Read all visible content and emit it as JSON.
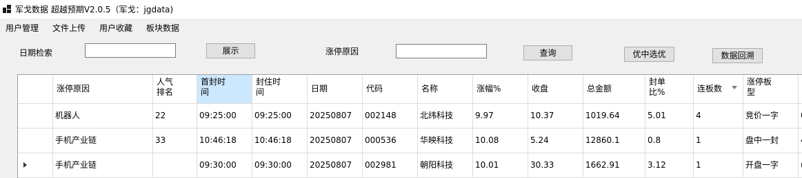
{
  "window": {
    "title": "军戈数据 超越预期V2.0.5（军戈：jgdata)"
  },
  "menu": [
    "用户管理",
    "文件上传",
    "用户收藏",
    "板块数据"
  ],
  "toolbar": {
    "date_label": "日期检索",
    "date_value": "",
    "show_button": "展示",
    "reason_label": "涨停原因",
    "reason_value": "",
    "query_button": "查询",
    "select_button": "优中选优",
    "backtrack_button": "数据回溯"
  },
  "table": {
    "columns": [
      "涨停原因",
      "人气排名",
      "首封时间",
      "封住时间",
      "日期",
      "代码",
      "名称",
      "涨幅%",
      "收盘",
      "总金额",
      "封单比%",
      "连板数",
      "涨停板型"
    ],
    "rows": [
      [
        "机器人",
        "22",
        "09:25:00",
        "09:25:00",
        "20250807",
        "002148",
        "北纬科技",
        "9.97",
        "10.37",
        "1019.64",
        "5.01",
        "4",
        "竞价一字"
      ],
      [
        "手机产业链",
        "33",
        "10:46:18",
        "10:46:18",
        "20250807",
        "000536",
        "华映科技",
        "10.08",
        "5.24",
        "12860.1",
        "0.8",
        "1",
        "盘中一封"
      ],
      [
        "手机产业链",
        "",
        "09:30:00",
        "09:30:00",
        "20250807",
        "002981",
        "朝阳科技",
        "10.01",
        "30.33",
        "1662.91",
        "3.12",
        "1",
        "开盘一字"
      ]
    ],
    "overflow_cells": [
      "0",
      "4",
      "("
    ],
    "selected_header": "首封时间",
    "sorted_column": "连板数"
  },
  "icons": {
    "app": "app-logo-icon",
    "sort": "sort-desc-icon",
    "row": "current-row-arrow-icon"
  }
}
